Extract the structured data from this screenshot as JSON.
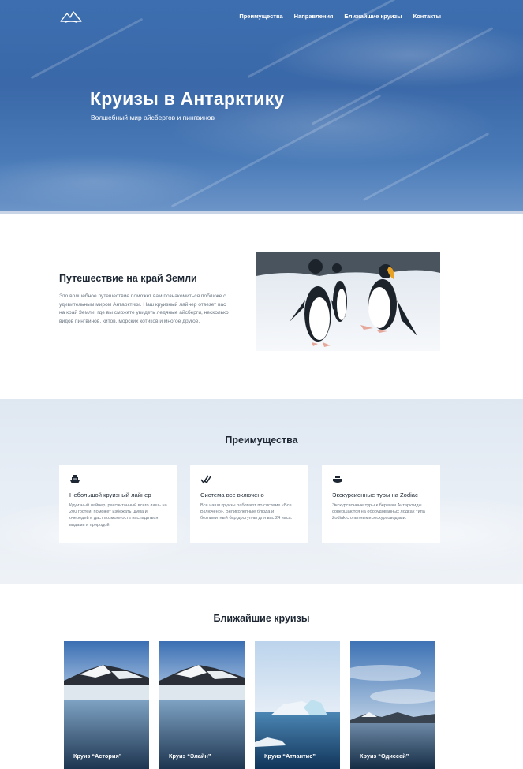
{
  "header": {
    "logo_icon": "mountain-logo-icon",
    "nav": [
      "Преимущества",
      "Направления",
      "Ближайшие круизы",
      "Контакты"
    ]
  },
  "hero": {
    "title": "Круизы в Антарктику",
    "subtitle": "Волшебный мир айсбергов и пингвинов"
  },
  "about": {
    "title": "Путешествие на край Земли",
    "text": "Это волшебное путешествие поможет вам познакомиться поближе с удивительным миром Антарктики. Наш круизный лайнер отвезет вас на край Земли, где вы сможете увидеть ледяные айсберги, несколько видов пингвинов, китов, морских котиков и многое другое.",
    "image": "penguins-photo"
  },
  "advantages": {
    "title": "Преимущества",
    "cards": [
      {
        "icon": "ship-icon",
        "title": "Небольшой круизный лайнер",
        "text": "Круизный лайнер, рассчитанный всего лишь на 200 гостей, поможет избежать шума и очередей и даст возможность насладиться видами и природой."
      },
      {
        "icon": "double-check-icon",
        "title": "Система все включено",
        "text": "Все наши круизы работают по системе «Все Включено». Великолепные блюда и безлимитный бар доступны для вас 24 часа."
      },
      {
        "icon": "boat-icon",
        "title": "Экскурсионные туры на Zodiac",
        "text": "Экскурсионные туры к берегам Антарктиды совершаются на оборудованных лодках типа Zodiak с опытными экскурсоводами."
      }
    ]
  },
  "cruises": {
    "title": "Ближайшие круизы",
    "items": [
      "Круиз “Астория”",
      "Круиз “Элайн”",
      "Круиз “Атлантис”",
      "Круиз “Одиссей”"
    ]
  }
}
